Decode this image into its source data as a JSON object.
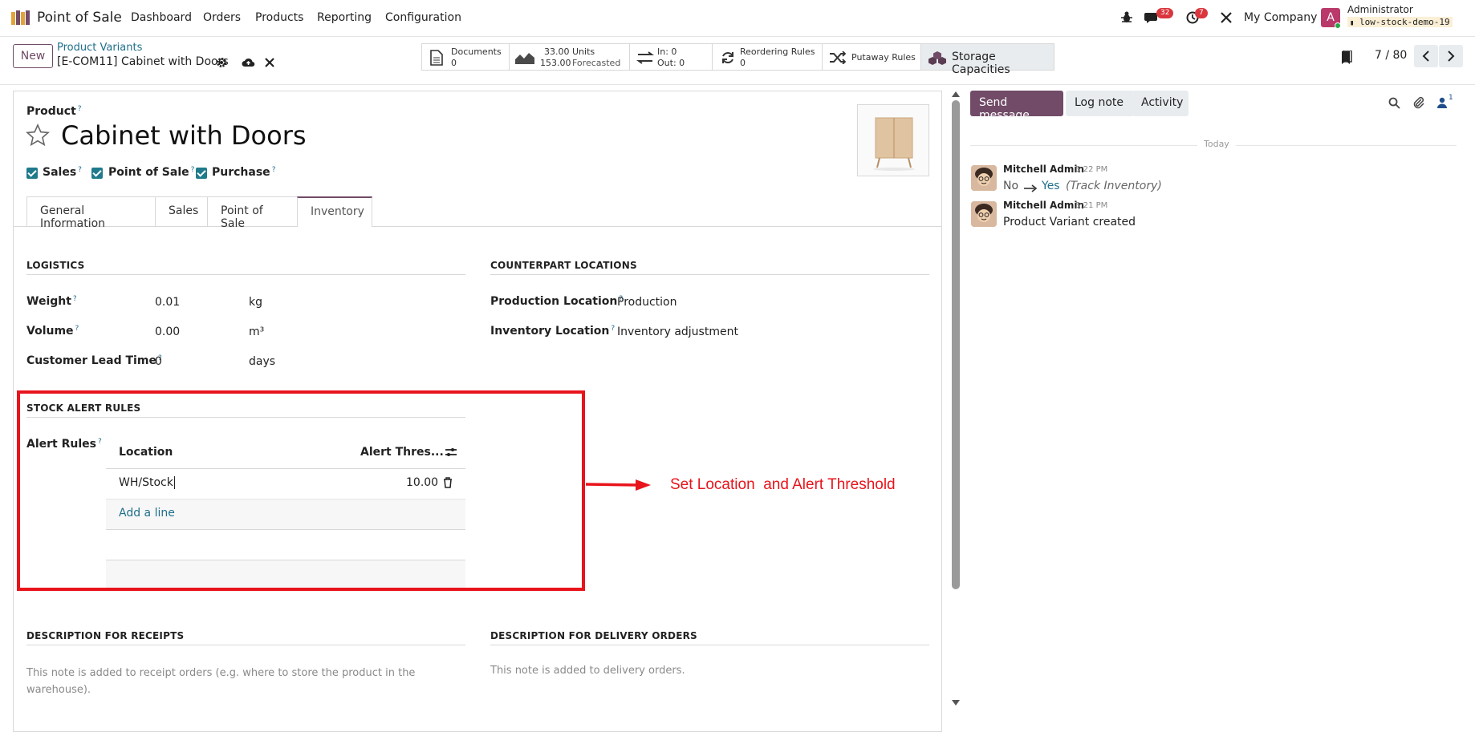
{
  "app": {
    "name": "Point of Sale"
  },
  "nav": {
    "menu": [
      "Dashboard",
      "Orders",
      "Products",
      "Reporting",
      "Configuration"
    ],
    "messages_count": "32",
    "activities_count": "7",
    "company": "My Company",
    "user": {
      "initial": "A",
      "name": "Administrator",
      "db": "low-stock-demo-19"
    }
  },
  "control": {
    "new_label": "New",
    "breadcrumb_parent": "Product Variants",
    "record_title": "[E-COM11] Cabinet with Doors",
    "pager": "7 / 80"
  },
  "smart_buttons": {
    "documents": {
      "label": "Documents",
      "value": "0"
    },
    "units": {
      "value": "33.00 Units",
      "forecast_value": "153.00",
      "forecast_label": "Forecasted"
    },
    "in_out": {
      "in": "In: 0",
      "out": "Out: 0"
    },
    "reordering": {
      "label": "Reordering Rules",
      "value": "0"
    },
    "putaway": {
      "label": "Putaway Rules"
    },
    "storage": {
      "label": "Storage Capacities"
    }
  },
  "product": {
    "type_label": "Product",
    "name": "Cabinet with Doors",
    "flags": [
      "Sales",
      "Point of Sale",
      "Purchase"
    ]
  },
  "tabs": [
    "General Information",
    "Sales",
    "Point of Sale",
    "Inventory"
  ],
  "logistics": {
    "title": "LOGISTICS",
    "weight": {
      "label": "Weight",
      "value": "0.01",
      "unit": "kg"
    },
    "volume": {
      "label": "Volume",
      "value": "0.00",
      "unit": "m³"
    },
    "lead_time": {
      "label": "Customer Lead Time",
      "value": "0",
      "unit": "days"
    }
  },
  "counterpart": {
    "title": "COUNTERPART LOCATIONS",
    "production": {
      "label": "Production Location",
      "value": "Production"
    },
    "inventory": {
      "label": "Inventory Location",
      "value": "Inventory adjustment"
    }
  },
  "stock_alert": {
    "title": "STOCK ALERT RULES",
    "label": "Alert Rules",
    "col_location": "Location",
    "col_threshold": "Alert Thres...",
    "rows": [
      {
        "location": "WH/Stock",
        "threshold": "10.00"
      }
    ],
    "add_line": "Add a line"
  },
  "annotation": {
    "text": "Set Location  and Alert Threshold",
    "color": "#e8141c"
  },
  "descriptions": {
    "receipts_title": "DESCRIPTION FOR RECEIPTS",
    "receipts_placeholder": "This note is added to receipt orders (e.g. where to store the product in the warehouse).",
    "delivery_title": "DESCRIPTION FOR DELIVERY ORDERS",
    "delivery_placeholder": "This note is added to delivery orders."
  },
  "chatter": {
    "send_message": "Send message",
    "log_note": "Log note",
    "activity": "Activity",
    "followers_count": "1",
    "date_divider": "Today",
    "messages": [
      {
        "author": "Mitchell Admin",
        "time": "5:22 PM",
        "old": "No",
        "new": "Yes",
        "field": "(Track Inventory)"
      },
      {
        "author": "Mitchell Admin",
        "time": "5:21 PM",
        "body": "Product Variant created"
      }
    ]
  },
  "colors": {
    "brand": "#714b67",
    "link": "#1f6f8b",
    "check": "#1f7a8c",
    "badge": "#d9363e"
  }
}
